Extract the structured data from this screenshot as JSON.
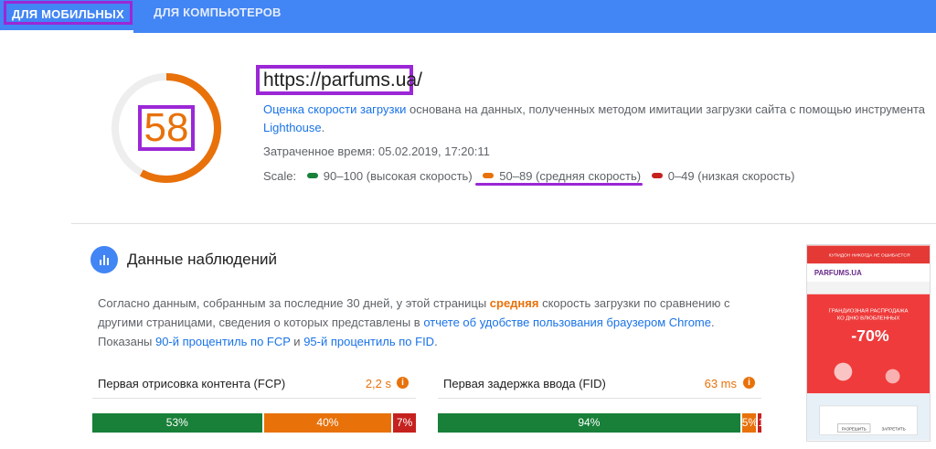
{
  "tabs": {
    "mobile": "ДЛЯ МОБИЛЬНЫХ",
    "desktop": "ДЛЯ КОМПЬЮТЕРОВ"
  },
  "summary": {
    "score": "58",
    "url": "https://parfums.ua/",
    "desc_link1": "Оценка скорости загрузки",
    "desc_text": " основана на данных, полученных методом имитации загрузки сайта с помощью инструмента ",
    "desc_link2": "Lighthouse",
    "desc_end": ".",
    "time": "Затраченное время: 05.02.2019, 17:20:11",
    "scale_label": "Scale:",
    "scale_fast": "90–100 (высокая скорость)",
    "scale_avg": "50–89 (средняя скорость)",
    "scale_slow": "0–49 (низкая скорость)"
  },
  "field": {
    "title": "Данные наблюдений",
    "t1": "Согласно данным, собранным за последние 30 дней, у этой страницы ",
    "t_avg": "средняя",
    "t2": " скорость загрузки по сравнению с другими страницами, сведения о которых представлены в ",
    "link_report": "отчете об удобстве пользования браузером Chrome",
    "t3": ".",
    "t4": "Показаны ",
    "link_fcp": "90-й процентиль по FCP",
    "t5": " и ",
    "link_fid": "95-й процентиль по FID",
    "t6": "."
  },
  "metrics": {
    "fcp": {
      "name": "Первая отрисовка контента (FCP)",
      "value": "2,2 s",
      "bars": [
        {
          "label": "53%",
          "pct": 53
        },
        {
          "label": "40%",
          "pct": 40
        },
        {
          "label": "7%",
          "pct": 7
        }
      ]
    },
    "fid": {
      "name": "Первая задержка ввода (FID)",
      "value": "63 ms",
      "bars": [
        {
          "label": "94%",
          "pct": 94
        },
        {
          "label": "5%",
          "pct": 5
        },
        {
          "label": "1%",
          "pct": 1
        }
      ]
    }
  },
  "thumbnail": {
    "banner_top": "КУПИДОН НИКОГДА НЕ ОШИБАЕТСЯ",
    "logo": "PARFUMS.UA",
    "promo1": "ГРАНДИОЗНАЯ РАСПРОДАЖА",
    "promo2": "КО ДНЮ ВЛЮБЛЕННЫХ",
    "discount": "-70%",
    "btn_allow": "РАЗРЕШИТЬ",
    "btn_deny": "ЗАПРЕТИТЬ"
  },
  "colors": {
    "brand": "#4285f4",
    "fast": "#188038",
    "average": "#e8710a",
    "slow": "#c5221f",
    "highlight": "#9b27d6"
  }
}
